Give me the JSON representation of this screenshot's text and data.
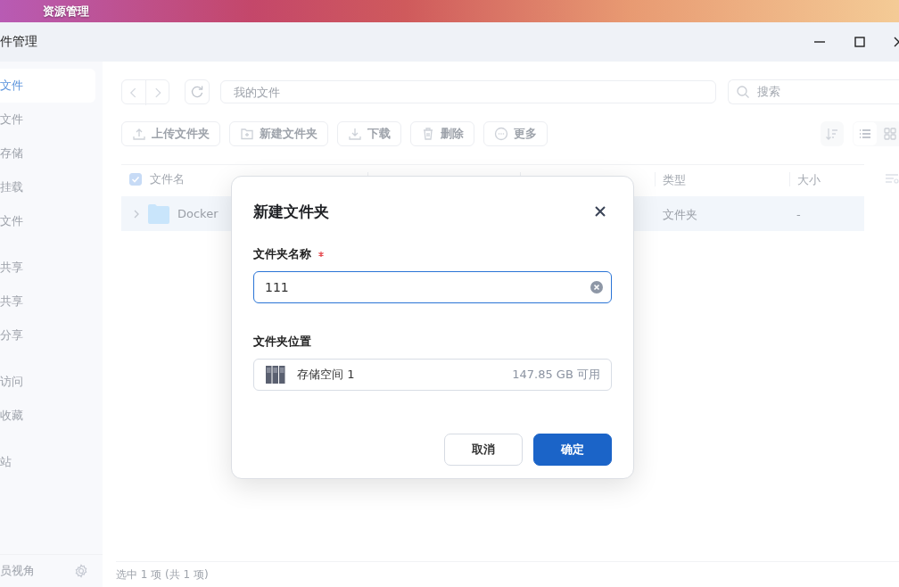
{
  "desktop_bar": {
    "title": "资源管理"
  },
  "window": {
    "title": "件管理"
  },
  "sidebar": {
    "groups": [
      {
        "items": [
          {
            "label": "文件",
            "selected": true
          },
          {
            "label": "文件",
            "selected": false
          },
          {
            "label": "存储",
            "selected": false
          },
          {
            "label": "挂载",
            "selected": false
          },
          {
            "label": "文件",
            "selected": false
          }
        ]
      },
      {
        "items": [
          {
            "label": "共享",
            "selected": false
          },
          {
            "label": "共享",
            "selected": false
          },
          {
            "label": "分享",
            "selected": false
          }
        ]
      },
      {
        "items": [
          {
            "label": "访问",
            "selected": false
          },
          {
            "label": "收藏",
            "selected": false
          }
        ]
      },
      {
        "items": [
          {
            "label": "站",
            "selected": false
          }
        ]
      }
    ],
    "footer": "员视角"
  },
  "toolbar": {
    "path": "我的文件",
    "search": {
      "placeholder": "搜索"
    },
    "actions": [
      {
        "label": "上传文件夹",
        "kind": "upload"
      },
      {
        "label": "新建文件夹",
        "kind": "newfolder"
      },
      {
        "label": "下载",
        "kind": "download"
      },
      {
        "label": "删除",
        "kind": "delete"
      },
      {
        "label": "更多",
        "kind": "more"
      }
    ],
    "views": [
      {
        "kind": "list",
        "selected": true
      },
      {
        "kind": "grid",
        "selected": false
      }
    ]
  },
  "table": {
    "select_all": {
      "checked": true
    },
    "columns": [
      {
        "label": "文件名"
      },
      {
        "label": "类型"
      },
      {
        "label": "大小"
      }
    ],
    "rows": [
      {
        "name": "Docker",
        "type": "文件夹",
        "size": "-",
        "selected": true
      }
    ]
  },
  "status_bar": "选中 1 项 (共 1 项)",
  "dialog": {
    "title": "新建文件夹",
    "name_field": {
      "label": "文件夹名称",
      "required": true,
      "value": "111"
    },
    "location": {
      "label": "文件夹位置",
      "volume": "存储空间 1",
      "free": "147.85 GB 可用"
    },
    "buttons": [
      {
        "label": "取消",
        "primary": false
      },
      {
        "label": "确定",
        "primary": true
      }
    ]
  }
}
